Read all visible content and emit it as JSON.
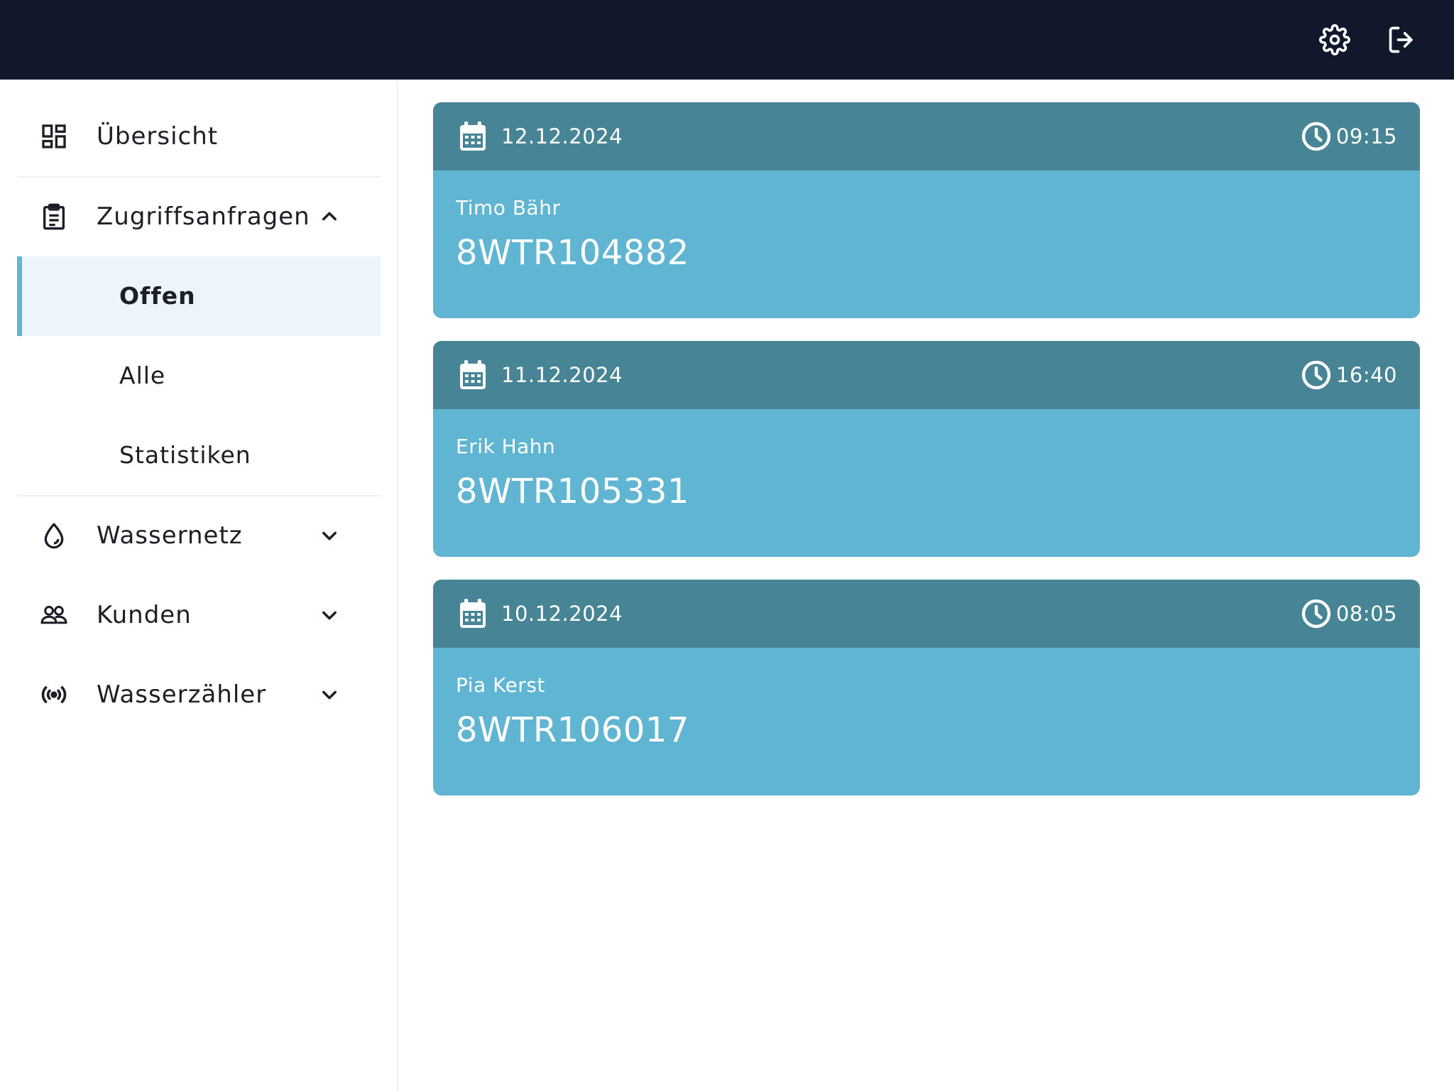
{
  "header": {
    "settings_icon": "gear-icon",
    "logout_icon": "logout-icon",
    "background": "#11182b"
  },
  "sidebar": {
    "items": [
      {
        "label": "Übersicht",
        "icon": "dashboard-icon"
      },
      {
        "label": "Zugriffsanfragen",
        "icon": "clipboard-icon",
        "expanded": true,
        "children": [
          {
            "label": "Offen",
            "active": true
          },
          {
            "label": "Alle"
          },
          {
            "label": "Statistiken"
          }
        ]
      },
      {
        "label": "Wassernetz",
        "icon": "water-drop-icon",
        "expanded": false
      },
      {
        "label": "Kunden",
        "icon": "users-icon",
        "expanded": false
      },
      {
        "label": "Wasserzähler",
        "icon": "signal-icon",
        "expanded": false
      }
    ]
  },
  "requests": [
    {
      "date": "12.12.2024",
      "time": "09:15",
      "name": "Timo Bähr",
      "code": "8WTR104882"
    },
    {
      "date": "11.12.2024",
      "time": "16:40",
      "name": "Erik Hahn",
      "code": "8WTR105331"
    },
    {
      "date": "10.12.2024",
      "time": "08:05",
      "name": "Pia Kerst",
      "code": "8WTR106017"
    }
  ],
  "colors": {
    "card_header": "#468496",
    "card_body": "#60b5d3",
    "active_accent": "#5fb5d4",
    "active_bg": "#ebf5fb"
  }
}
